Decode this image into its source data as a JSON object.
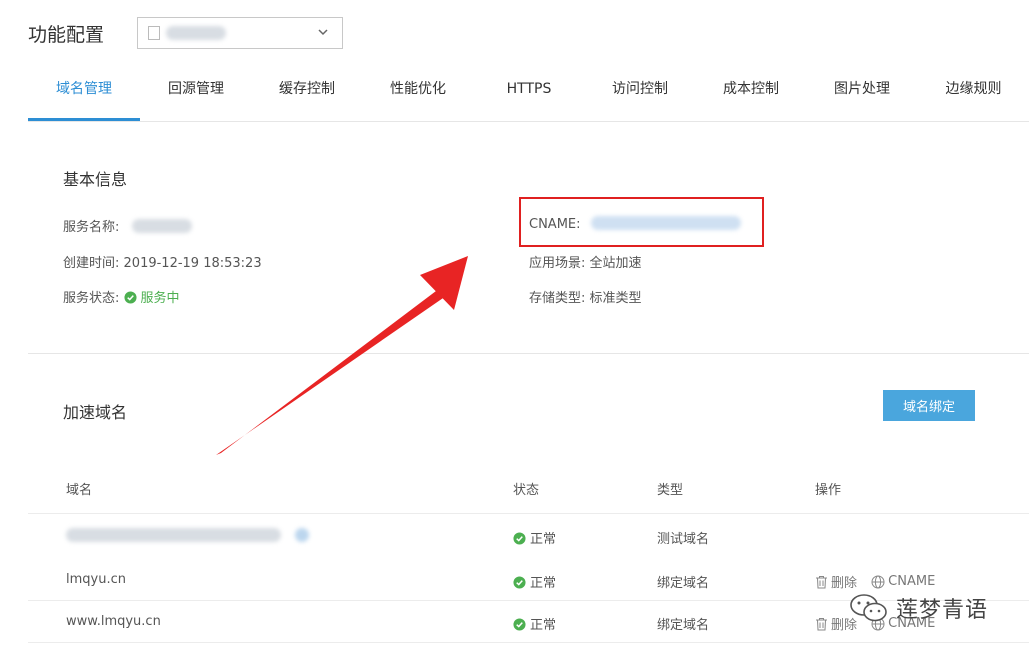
{
  "header": {
    "title": "功能配置"
  },
  "tabs": [
    {
      "label": "域名管理",
      "active": true
    },
    {
      "label": "回源管理"
    },
    {
      "label": "缓存控制"
    },
    {
      "label": "性能优化"
    },
    {
      "label": "HTTPS"
    },
    {
      "label": "访问控制"
    },
    {
      "label": "成本控制"
    },
    {
      "label": "图片处理"
    },
    {
      "label": "边缘规则"
    }
  ],
  "basic": {
    "title": "基本信息",
    "service_name_label": "服务名称:",
    "created_label": "创建时间:",
    "created_value": "2019-12-19 18:53:23",
    "status_label": "服务状态:",
    "status_value": "服务中",
    "cname_label": "CNAME:",
    "scene_label": "应用场景:",
    "scene_value": "全站加速",
    "storage_label": "存储类型:",
    "storage_value": "标准类型"
  },
  "domains": {
    "title": "加速域名",
    "bind_button": "域名绑定",
    "headers": {
      "domain": "域名",
      "status": "状态",
      "type": "类型",
      "ops": "操作"
    },
    "rows": [
      {
        "domain": "",
        "status": "正常",
        "type": "测试域名"
      },
      {
        "domain": "lmqyu.cn",
        "status": "正常",
        "type": "绑定域名",
        "delete": "删除",
        "cname": "CNAME"
      },
      {
        "domain": "www.lmqyu.cn",
        "status": "正常",
        "type": "绑定域名",
        "delete": "删除",
        "cname": "CNAME"
      }
    ]
  },
  "watermark": {
    "text": "莲梦青语"
  },
  "colors": {
    "accent": "#2d8ed4",
    "ok": "#4caf50",
    "highlight": "#e02020",
    "button": "#4aa6dd"
  }
}
